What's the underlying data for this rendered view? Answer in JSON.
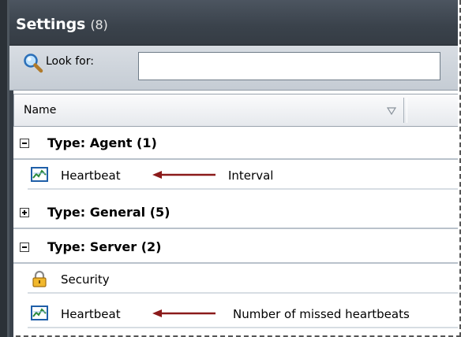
{
  "window": {
    "title": "Settings",
    "count": "(8)"
  },
  "search": {
    "label": "Look for:",
    "value": ""
  },
  "columns": {
    "name": "Name"
  },
  "groups": [
    {
      "label": "Type: Agent (1)",
      "expanded": true,
      "items": [
        {
          "label": "Heartbeat",
          "icon": "monitor-chart-icon",
          "annotation": "Interval"
        }
      ]
    },
    {
      "label": "Type: General (5)",
      "expanded": false,
      "items": []
    },
    {
      "label": "Type: Server (2)",
      "expanded": true,
      "items": [
        {
          "label": "Security",
          "icon": "lock-icon",
          "annotation": ""
        },
        {
          "label": "Heartbeat",
          "icon": "monitor-chart-icon",
          "annotation": "Number of missed heartbeats"
        }
      ]
    }
  ],
  "colors": {
    "arrow": "#8b1a1a",
    "titlebar": "#3f474f",
    "search_bg": "#cdd3da"
  }
}
